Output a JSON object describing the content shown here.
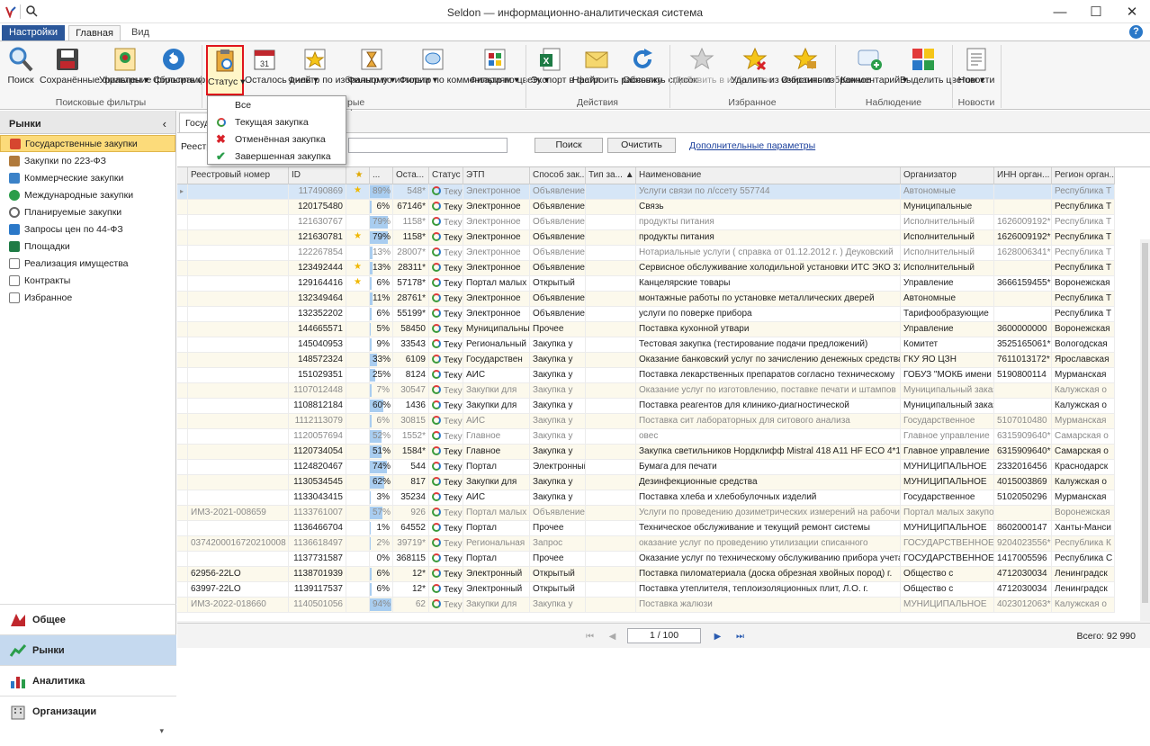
{
  "window": {
    "title": "Seldon — информационно-аналитическая система"
  },
  "tabs": {
    "file": "Настройки",
    "home": "Главная",
    "view": "Вид"
  },
  "help": "?",
  "ribbon": {
    "buttons": [
      {
        "label": "Поиск"
      },
      {
        "label": "Сохранённые фильтры ▾"
      },
      {
        "label": "Управление фильтрами"
      },
      {
        "label": "Сбросить фильтр"
      },
      {
        "label": "Статус ▾"
      },
      {
        "label": "Осталось дней ▾"
      },
      {
        "label": "Фильтр по избранному ▾"
      },
      {
        "label": "Фильтр по истории ▾"
      },
      {
        "label": "Фильтр по комментариям ▾"
      },
      {
        "label": "Фильтр по цвету ▾"
      },
      {
        "label": "Экспорт в файл"
      },
      {
        "label": "Настроить рассылку"
      },
      {
        "label": "Обновить список"
      },
      {
        "label": "Добавить в избранное"
      },
      {
        "label": "Удалить из избранного"
      },
      {
        "label": "Очистить избранное"
      },
      {
        "label": "Комментарий ▾"
      },
      {
        "label": "Выделить цветом ▾"
      },
      {
        "label": "Новости"
      }
    ],
    "groups": {
      "search": "Поисковые фильтры",
      "filters": "рые фильтры",
      "actions": "Действия",
      "favorites": "Избранное",
      "watch": "Наблюдение",
      "news": "Новости"
    }
  },
  "status_menu": [
    "Все",
    "Текущая закупка",
    "Отменённая закупка",
    "Завершенная закупка"
  ],
  "sidebar": {
    "title": "Рынки",
    "items": [
      "Государственные закупки",
      "Закупки по 223-ФЗ",
      "Коммерческие закупки",
      "Международные закупки",
      "Планируемые закупки",
      "Запросы цен по 44-ФЗ",
      "Площадки",
      "Реализация имущества",
      "Контракты",
      "Избранное"
    ],
    "bottom": [
      "Общее",
      "Рынки",
      "Аналитика",
      "Организации"
    ]
  },
  "doc_tab": "Госуд",
  "filter": {
    "label": "Реестр",
    "search": "Поиск",
    "clear": "Очистить",
    "more": "Дополнительные параметры"
  },
  "grid": {
    "columns": [
      "Реестровый номер",
      "ID",
      "★",
      "...",
      "Оста...",
      "Статус",
      "ЭТП",
      "Способ зак...",
      "Тип за... ▲",
      "Наименование",
      "Организатор",
      "ИНН орган...",
      "Регион орган..."
    ],
    "rows": [
      {
        "reg": "",
        "id": "117490869",
        "star": true,
        "pct": "89%",
        "p": 0.89,
        "rest": "548*",
        "status": "Текущ...",
        "etp": "Электронное",
        "method": "Объявление",
        "type": "",
        "name": "Услуги связи по л/ссету 557744",
        "org": "Автономные",
        "inn": "",
        "region": "Республика Т",
        "grey": true
      },
      {
        "reg": "",
        "id": "120175480",
        "star": false,
        "pct": "6%",
        "p": 0.06,
        "rest": "67146*",
        "status": "Текущ...",
        "etp": "Электронное",
        "method": "Объявление",
        "type": "",
        "name": "Связь",
        "org": "Муниципальные",
        "inn": "",
        "region": "Республика Т",
        "grey": false
      },
      {
        "reg": "",
        "id": "121630767",
        "star": false,
        "pct": "79%",
        "p": 0.79,
        "rest": "1158*",
        "status": "Текущ...",
        "etp": "Электронное",
        "method": "Объявление",
        "type": "",
        "name": "продукты питания",
        "org": "Исполнительный",
        "inn": "1626009192*",
        "region": "Республика Т",
        "grey": true
      },
      {
        "reg": "",
        "id": "121630781",
        "star": true,
        "pct": "79%",
        "p": 0.79,
        "rest": "1158*",
        "status": "Текущ...",
        "etp": "Электронное",
        "method": "Объявление",
        "type": "",
        "name": "продукты питания",
        "org": "Исполнительный",
        "inn": "1626009192*",
        "region": "Республика Т",
        "grey": false
      },
      {
        "reg": "",
        "id": "122267854",
        "star": false,
        "pct": "13%",
        "p": 0.13,
        "rest": "28007*",
        "status": "Текущ...",
        "etp": "Электронное",
        "method": "Объявление",
        "type": "",
        "name": "Нотариальные услуги ( справка от 01.12.2012 г. ) Деуковский",
        "org": "Исполнительный",
        "inn": "1628006341*",
        "region": "Республика Т",
        "grey": true
      },
      {
        "reg": "",
        "id": "123492444",
        "star": true,
        "pct": "13%",
        "p": 0.13,
        "rest": "28311*",
        "status": "Текущ...",
        "etp": "Электронное",
        "method": "Объявление",
        "type": "",
        "name": "Сервисное обслуживание холодильной установки ИТС ЭКО 320",
        "org": "Исполнительный",
        "inn": "",
        "region": "Республика Т",
        "grey": false
      },
      {
        "reg": "",
        "id": "129164416",
        "star": true,
        "pct": "6%",
        "p": 0.06,
        "rest": "57178*",
        "status": "Текущ...",
        "etp": "Портал малых",
        "method": "Открытый",
        "type": "",
        "name": "Канцелярские товары",
        "org": "Управление",
        "inn": "3666159455*",
        "region": "Воронежская",
        "grey": false
      },
      {
        "reg": "",
        "id": "132349464",
        "star": false,
        "pct": "11%",
        "p": 0.11,
        "rest": "28761*",
        "status": "Текущ...",
        "etp": "Электронное",
        "method": "Объявление",
        "type": "",
        "name": "монтажные работы по установке металлических дверей",
        "org": "Автономные",
        "inn": "",
        "region": "Республика Т",
        "grey": false
      },
      {
        "reg": "",
        "id": "132352202",
        "star": false,
        "pct": "6%",
        "p": 0.06,
        "rest": "55199*",
        "status": "Текущ...",
        "etp": "Электронное",
        "method": "Объявление",
        "type": "",
        "name": "услуги по поверке прибора",
        "org": "Тарифообразующие",
        "inn": "",
        "region": "Республика Т",
        "grey": false
      },
      {
        "reg": "",
        "id": "144665571",
        "star": false,
        "pct": "5%",
        "p": 0.05,
        "rest": "58450",
        "status": "Текущ...",
        "etp": "Муниципальны",
        "method": "Прочее",
        "type": "",
        "name": "Поставка кухонной утвари",
        "org": "Управление",
        "inn": "3600000000",
        "region": "Воронежская",
        "grey": false
      },
      {
        "reg": "",
        "id": "145040953",
        "star": false,
        "pct": "9%",
        "p": 0.09,
        "rest": "33543",
        "status": "Текущ...",
        "etp": "Региональный",
        "method": "Закупка у",
        "type": "",
        "name": "Тестовая закупка (тестирование подачи предложений)",
        "org": "Комитет",
        "inn": "3525165061*",
        "region": "Вологодская",
        "grey": false
      },
      {
        "reg": "",
        "id": "148572324",
        "star": false,
        "pct": "33%",
        "p": 0.33,
        "rest": "6109",
        "status": "Текущ...",
        "etp": "Государствен",
        "method": "Закупка у",
        "type": "",
        "name": "Оказание банковский услуг по зачислению денежных средства",
        "org": "ГКУ ЯО ЦЗН",
        "inn": "7611013172*",
        "region": "Ярославская",
        "grey": false
      },
      {
        "reg": "",
        "id": "151029351",
        "star": false,
        "pct": "25%",
        "p": 0.25,
        "rest": "8124",
        "status": "Текущ...",
        "etp": "АИС",
        "method": "Закупка у",
        "type": "",
        "name": "Поставка лекарственных препаратов согласно техническому",
        "org": "ГОБУЗ \"МОКБ имени",
        "inn": "5190800114",
        "region": "Мурманская",
        "grey": false
      },
      {
        "reg": "",
        "id": "1107012448",
        "star": false,
        "pct": "7%",
        "p": 0.07,
        "rest": "30547",
        "status": "Текущ...",
        "etp": "Закупки для",
        "method": "Закупка у",
        "type": "",
        "name": "Оказание услуг по изготовлению, поставке печати и штампов",
        "org": "Муниципальный заказ",
        "inn": "",
        "region": "Калужская о",
        "grey": true
      },
      {
        "reg": "",
        "id": "1108812184",
        "star": false,
        "pct": "60%",
        "p": 0.6,
        "rest": "1436",
        "status": "Текущ...",
        "etp": "Закупки для",
        "method": "Закупка у",
        "type": "",
        "name": "Поставка реагентов для клинико-диагностической",
        "org": "Муниципальный заказ",
        "inn": "",
        "region": "Калужская о",
        "grey": false
      },
      {
        "reg": "",
        "id": "1112113079",
        "star": false,
        "pct": "6%",
        "p": 0.06,
        "rest": "30815",
        "status": "Текущ...",
        "etp": "АИС",
        "method": "Закупка у",
        "type": "",
        "name": "Поставка сит лабораторных для ситового анализа",
        "org": "Государственное",
        "inn": "5107010480",
        "region": "Мурманская",
        "grey": true
      },
      {
        "reg": "",
        "id": "1120057694",
        "star": false,
        "pct": "52%",
        "p": 0.52,
        "rest": "1552*",
        "status": "Текущ...",
        "etp": "Главное",
        "method": "Закупка у",
        "type": "",
        "name": "овес",
        "org": "Главное управление",
        "inn": "6315909640*",
        "region": "Самарская о",
        "grey": true
      },
      {
        "reg": "",
        "id": "1120734054",
        "star": false,
        "pct": "51%",
        "p": 0.51,
        "rest": "1584*",
        "status": "Текущ...",
        "etp": "Главное",
        "method": "Закупка у",
        "type": "",
        "name": "Закупка светильников Нордклифф Mistral 418 A11 HF ECO 4*18",
        "org": "Главное управление",
        "inn": "6315909640*",
        "region": "Самарская о",
        "grey": false
      },
      {
        "reg": "",
        "id": "1124820467",
        "star": false,
        "pct": "74%",
        "p": 0.74,
        "rest": "544",
        "status": "Текущ...",
        "etp": "Портал",
        "method": "Электронный",
        "type": "",
        "name": "Бумага для печати",
        "org": "МУНИЦИПАЛЬНОЕ",
        "inn": "2332016456",
        "region": "Краснодарск",
        "grey": false
      },
      {
        "reg": "",
        "id": "1130534545",
        "star": false,
        "pct": "62%",
        "p": 0.62,
        "rest": "817",
        "status": "Текущ...",
        "etp": "Закупки для",
        "method": "Закупка у",
        "type": "",
        "name": "Дезинфекционные средства",
        "org": "МУНИЦИПАЛЬНОЕ",
        "inn": "4015003869",
        "region": "Калужская о",
        "grey": false
      },
      {
        "reg": "",
        "id": "1133043415",
        "star": false,
        "pct": "3%",
        "p": 0.03,
        "rest": "35234",
        "status": "Текущ...",
        "etp": "АИС",
        "method": "Закупка у",
        "type": "",
        "name": "Поставка хлеба и хлебобулочных изделий",
        "org": "Государственное",
        "inn": "5102050296",
        "region": "Мурманская",
        "grey": false
      },
      {
        "reg": "ИМЗ-2021-008659",
        "id": "1133761007",
        "star": false,
        "pct": "57%",
        "p": 0.57,
        "rest": "926",
        "status": "Текущ...",
        "etp": "Портал малых",
        "method": "Объявление",
        "type": "",
        "name": "Услуги по проведению дозиметрических измерений на рабочих",
        "org": "Портал малых закупок",
        "inn": "",
        "region": "Воронежская",
        "grey": true
      },
      {
        "reg": "",
        "id": "1136466704",
        "star": false,
        "pct": "1%",
        "p": 0.01,
        "rest": "64552",
        "status": "Текущ...",
        "etp": "Портал",
        "method": "Прочее",
        "type": "",
        "name": "Техническое обслуживание и текущий ремонт системы",
        "org": "МУНИЦИПАЛЬНОЕ",
        "inn": "8602000147",
        "region": "Ханты-Манси",
        "grey": false
      },
      {
        "reg": "0374200016720210008",
        "id": "1136618497",
        "star": false,
        "pct": "2%",
        "p": 0.02,
        "rest": "39719*",
        "status": "Текущ...",
        "etp": "Региональная",
        "method": "Запрос",
        "type": "",
        "name": "оказание услуг по проведению утилизации списанного",
        "org": "ГОСУДАРСТВЕННОЕ",
        "inn": "9204023556*",
        "region": "Республика К",
        "grey": true
      },
      {
        "reg": "",
        "id": "1137731587",
        "star": false,
        "pct": "0%",
        "p": 0.0,
        "rest": "368115",
        "status": "Текущ...",
        "etp": "Портал",
        "method": "Прочее",
        "type": "",
        "name": "Оказание услуг по техническому обслуживанию прибора учета",
        "org": "ГОСУДАРСТВЕННОЕ",
        "inn": "1417005596",
        "region": "Республика С",
        "grey": false
      },
      {
        "reg": "62956-22LO",
        "id": "1138701939",
        "star": false,
        "pct": "6%",
        "p": 0.06,
        "rest": "12*",
        "status": "Текущ...",
        "etp": "Электронный",
        "method": "Открытый",
        "type": "",
        "name": "Поставка пиломатериала (доска обрезная хвойных пород) г.",
        "org": "Общество с",
        "inn": "4712030034",
        "region": "Ленинградск",
        "grey": false
      },
      {
        "reg": "63997-22LO",
        "id": "1139117537",
        "star": false,
        "pct": "6%",
        "p": 0.06,
        "rest": "12*",
        "status": "Текущ...",
        "etp": "Электронный",
        "method": "Открытый",
        "type": "",
        "name": "Поставка утеплителя, теплоизоляционных плит, Л.О. г.",
        "org": "Общество с",
        "inn": "4712030034",
        "region": "Ленинградск",
        "grey": false
      },
      {
        "reg": "ИМЗ-2022-018660",
        "id": "1140501056",
        "star": false,
        "pct": "94%",
        "p": 0.94,
        "rest": "62",
        "status": "Текущ...",
        "etp": "Закупки для",
        "method": "Закупка у",
        "type": "",
        "name": "Поставка жалюзи",
        "org": "МУНИЦИПАЛЬНОЕ",
        "inn": "4023012063*",
        "region": "Калужская о",
        "grey": true
      }
    ]
  },
  "pager": {
    "page": "1 / 100",
    "total_label": "Всего:",
    "total": "92 990"
  }
}
